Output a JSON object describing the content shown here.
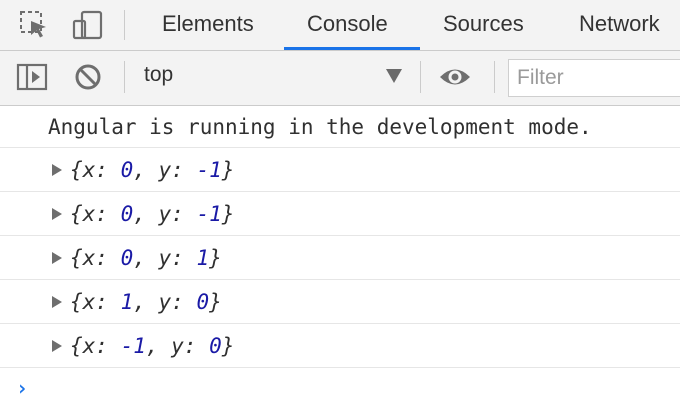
{
  "tabs": [
    {
      "label": "Elements"
    },
    {
      "label": "Console"
    },
    {
      "label": "Sources"
    },
    {
      "label": "Network"
    }
  ],
  "toolbar": {
    "context": "top",
    "filter_placeholder": "Filter"
  },
  "console": {
    "info_message": "Angular is running in the development mode.",
    "objects": [
      {
        "x": "0",
        "y": "-1"
      },
      {
        "x": "0",
        "y": "-1"
      },
      {
        "x": "0",
        "y": "1"
      },
      {
        "x": "1",
        "y": "0"
      },
      {
        "x": "-1",
        "y": "0"
      }
    ]
  },
  "colors": {
    "accent": "#1a73e8",
    "number": "#1a1aa6"
  },
  "icons": [
    "inspect-element-icon",
    "device-toolbar-icon",
    "sidebar-toggle-icon",
    "clear-console-icon",
    "dropdown-arrow-icon",
    "eye-icon",
    "prompt-chevron-icon"
  ]
}
